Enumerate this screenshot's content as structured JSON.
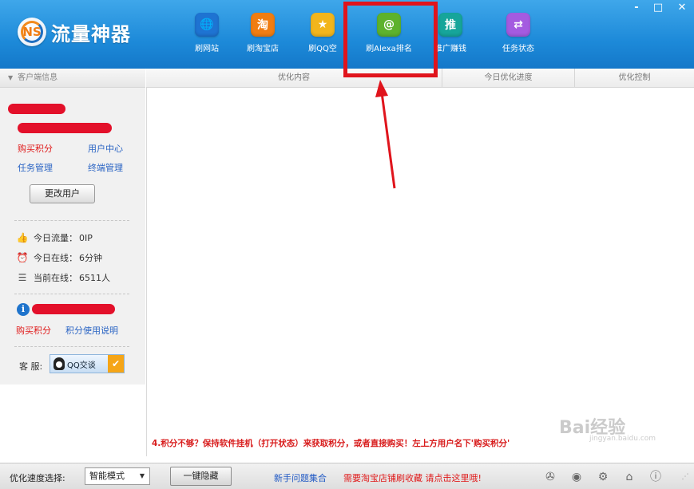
{
  "app": {
    "title": "流量神器",
    "logo_letters": "NS"
  },
  "window_controls": {
    "minimize": "-",
    "maximize": "□",
    "close": "✕"
  },
  "toolbar": [
    {
      "label": "刷网站",
      "icon": "globe-icon",
      "glyph": "🌐",
      "color": "#1e73d2"
    },
    {
      "label": "刷淘宝店",
      "icon": "taobao-icon",
      "glyph": "淘",
      "color": "#f07d12"
    },
    {
      "label": "刷QQ空",
      "icon": "star-icon",
      "glyph": "★",
      "color": "#f2b51c"
    },
    {
      "label": "刷Alexa排名",
      "icon": "at-icon",
      "glyph": "@",
      "color": "#5db22d"
    },
    {
      "label": "推广赚钱",
      "icon": "promote-icon",
      "glyph": "推",
      "color": "#16a59a"
    },
    {
      "label": "任务状态",
      "icon": "sync-icon",
      "glyph": "⇄",
      "color": "#a45be0"
    }
  ],
  "left_panel": {
    "header": "客户端信息",
    "buy_points": "购买积分",
    "user_center": "用户中心",
    "task_manage": "任务管理",
    "terminal_manage": "终端管理",
    "change_user": "更改用户",
    "stats": [
      {
        "icon": "thumb-icon",
        "glyph": "👍",
        "label": "今日流量：",
        "value": "0IP"
      },
      {
        "icon": "clock-icon",
        "glyph": "⏰",
        "label": "今日在线：",
        "value": "6分钟"
      },
      {
        "icon": "online-icon",
        "glyph": "☰",
        "label": "当前在线：",
        "value": "6511人"
      }
    ],
    "buy_points_2": "购买积分",
    "points_usage": "积分使用说明",
    "service_label": "客 服:",
    "qq_chat": "QQ交谈"
  },
  "columns": [
    "优化内容",
    "今日优化进度",
    "优化控制"
  ],
  "bottom_message": "4.积分不够？保持软件挂机（打开状态）来获取积分，或者直接购买！左上方用户名下'购买积分'",
  "statusbar": {
    "speed_label": "优化速度选择:",
    "speed_value": "智能模式",
    "hide_button": "一键隐藏",
    "faq_link": "新手问题集合",
    "promo_text": "需要淘宝店铺刷收藏 请点击这里哦!"
  },
  "watermark": {
    "main": "Bai经验",
    "sub": "jingyan.baidu.com"
  },
  "accent_colors": {
    "header": "#1d8ad9",
    "highlight_box": "#e0141c",
    "link": "#2a64c4",
    "alert": "#e01a1a"
  }
}
